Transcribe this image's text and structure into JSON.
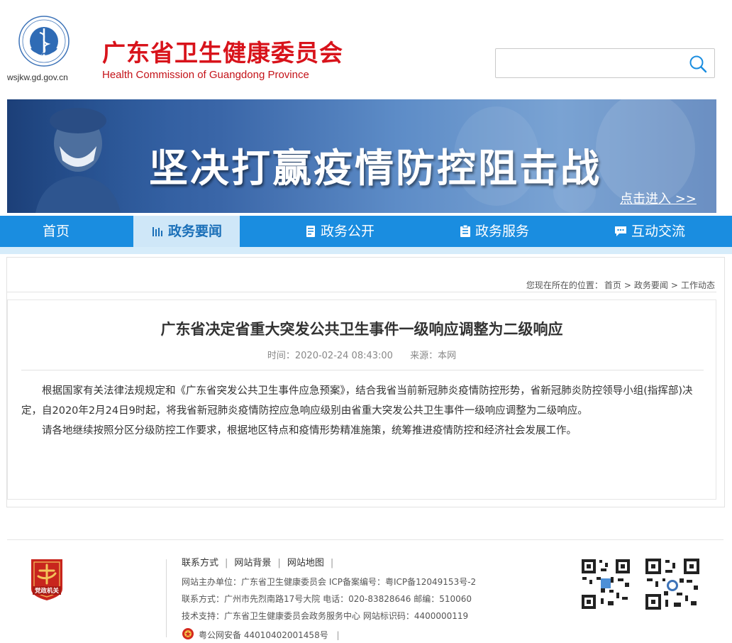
{
  "header": {
    "site_url": "wsjkw.gd.gov.cn",
    "title": "广东省卫生健康委员会",
    "subtitle": "Health Commission of Guangdong Province",
    "search": {
      "value": "",
      "placeholder": ""
    }
  },
  "banner": {
    "headline": "坚决打赢疫情防控阻击战",
    "link": "点击进入 >>"
  },
  "nav": {
    "items": [
      {
        "label": "首页"
      },
      {
        "label": "政务要闻"
      },
      {
        "label": "政务公开"
      },
      {
        "label": "政务服务"
      },
      {
        "label": "互动交流"
      }
    ],
    "active_index": 1
  },
  "breadcrumb": {
    "prefix": "您现在所在的位置：",
    "items": [
      "首页",
      "政务要闻",
      "工作动态"
    ],
    "separator": ">"
  },
  "article": {
    "title": "广东省决定省重大突发公共卫生事件一级响应调整为二级响应",
    "time": "时间：2020-02-24 08:43:00",
    "source": "来源：本网",
    "paragraphs": [
      "根据国家有关法律法规规定和《广东省突发公共卫生事件应急预案》，结合我省当前新冠肺炎疫情防控形势，省新冠肺炎防控领导小组(指挥部)决定，自2020年2月24日9时起，将我省新冠肺炎疫情防控应急响应级别由省重大突发公共卫生事件一级响应调整为二级响应。",
      "请各地继续按照分区分级防控工作要求，根据地区特点和疫情形势精准施策，统筹推进疫情防控和经济社会发展工作。"
    ]
  },
  "footer": {
    "links": [
      "联系方式",
      "网站背景",
      "网站地图"
    ],
    "host": "网站主办单位：广东省卫生健康委员会  ICP备案编号：粤ICP备12049153号-2",
    "contact": "联系方式：广州市先烈南路17号大院  电话：020-83828646  邮编：510060",
    "support": "技术支持：广东省卫生健康委员会政务服务中心  网站标识码：4400000119",
    "police": "粤公网安备 44010402001458号",
    "police_bar": "|",
    "badge_text": "党政机关"
  },
  "colors": {
    "brand_red": "#d8131b",
    "nav_blue": "#1a8de0",
    "nav_active_bg": "#cfe7f8",
    "banner_blue": "#3a66a8"
  }
}
